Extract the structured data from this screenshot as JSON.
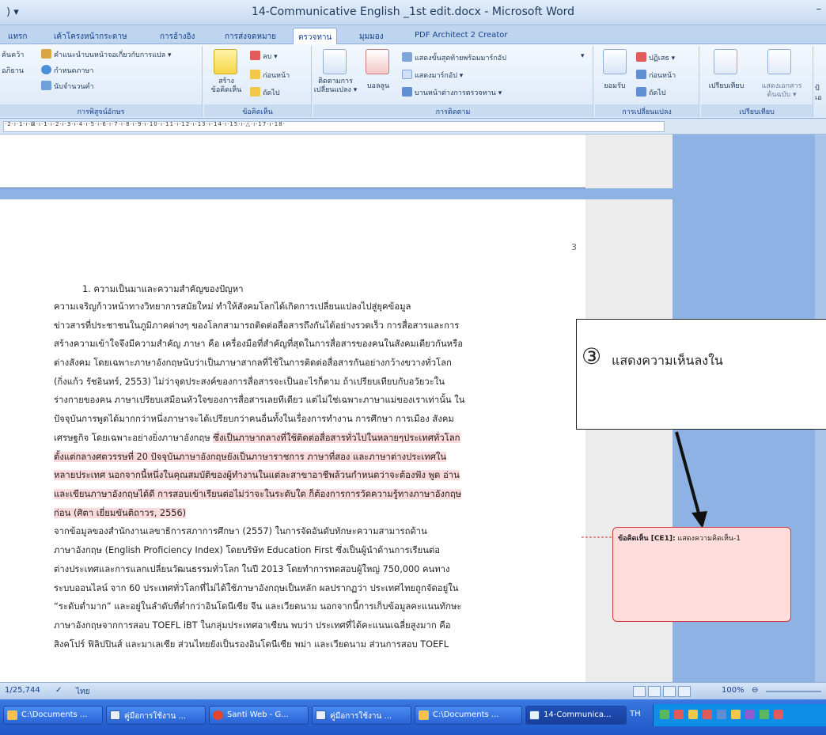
{
  "window": {
    "title": "14-Communicative English _1st edit.docx - Microsoft Word",
    "quick_access": ") ▾",
    "minimize": "–"
  },
  "tabs": [
    {
      "label": "แทรก"
    },
    {
      "label": "เค้าโครงหน้ากระดาษ"
    },
    {
      "label": "การอ้างอิง"
    },
    {
      "label": "การส่งจดหมาย"
    },
    {
      "label": "ตรวจทาน",
      "active": true
    },
    {
      "label": "มุมมอง"
    },
    {
      "label": "PDF Architect 2 Creator"
    }
  ],
  "ribbon": {
    "proofing": {
      "label": "การพิสูจน์อักษร",
      "items": [
        "ค้นคว้า",
        "คำแนะนำบนหน้าจอเกี่ยวกับการแปล ▾",
        "อภิธาน",
        "กำหนดภาษา",
        "นับจำนวนคำ"
      ]
    },
    "comments": {
      "label": "ข้อคิดเห็น",
      "new_comment": "สร้าง",
      "new_comment_2": "ข้อคิดเห็น",
      "delete": "ลบ ▾",
      "previous": "ก่อนหน้า",
      "next": "ถัดไป"
    },
    "tracking": {
      "label": "การติดตาม",
      "track_changes": "ติดตามการ",
      "track_changes_2": "เปลี่ยนแปลง ▾",
      "balloons": "บอลลูน",
      "display_select": "แสดงขั้นสุดท้ายพร้อมมาร์กอัป",
      "show_markup": "แสดงมาร์กอัป ▾",
      "reviewing_pane": "บานหน้าต่างการตรวจทาน ▾"
    },
    "changes": {
      "label": "การเปลี่ยนแปลง",
      "accept": "ยอมรับ",
      "reject": "ปฏิเสธ ▾",
      "previous": "ก่อนหน้า",
      "next": "ถัดไป"
    },
    "compare": {
      "label": "เปรียบเทียบ",
      "compare": "เปรียบเทียบ",
      "show_source": "แสดงเอกสาร",
      "show_source_2": "ต้นฉบับ ▾"
    },
    "extra": "ป้ เอ"
  },
  "ruler": {
    "ticks": "·2·ı·1·ı·⊠·ı·1·ı·2·ı·3·ı·4·ı·5·ı·6·ı·7·ı·8·ı·9·ı·10·ı·11·ı·12·ı·13·ı·14·ı·15·ı·△·ı·17·ı·18·"
  },
  "document": {
    "page_number": "3",
    "lines": [
      "1.  ความเป็นมาและความสำคัญของปัญหา",
      "          ความเจริญก้าวหน้าทางวิทยาการสมัยใหม่ ทำให้สังคมโลกได้เกิดการเปลี่ยนแปลงไปสู่ยุคข้อมูล",
      "ข่าวสารที่ประชาชนในภูมิภาคต่างๆ ของโลกสามารถติดต่อสื่อสารถึงกันได้อย่างรวดเร็ว การสื่อสารและการ",
      "สร้างความเข้าใจจึงมีความสำคัญ ภาษา คือ เครื่องมือที่สำคัญที่สุดในการสื่อสารของคนในสังคมเดียวกันหรือ",
      "ต่างสังคม โดยเฉพาะภาษาอังกฤษนับว่าเป็นภาษาสากลที่ใช้ในการติดต่อสื่อสารกันอย่างกว้างขวางทั่วโลก",
      "(กิ่งแก้ว รัชอินทร์, 2553) ไม่ว่าจุดประสงค์ของการสื่อสารจะเป็นอะไรก็ตาม ถ้าเปรียบเทียบกับอวัยวะใน",
      "ร่างกายของคน ภาษาเปรียบเสมือนหัวใจของการสื่อสารเลยทีเดียว แต่ไม่ใช่เฉพาะภาษาแม่ของเราเท่านั้น ใน",
      "ปัจจุบันการพูดได้มากกว่าหนึ่งภาษาจะได้เปรียบกว่าคนอื่นทั้งในเรื่องการทำงาน การศึกษา การเมือง สังคม",
      "เศรษฐกิจ โดยเฉพาะอย่างยิ่งภาษาอังกฤษ",
      "ตั้งแต่กลางศตวรรษที่ 20 ปัจจุบันภาษาอังกฤษยังเป็นภาษาราชการ ภาษาที่สอง และภาษาต่างประเทศใน",
      "หลายประเทศ นอกจากนี้หนึ่งในคุณสมบัติของผู้ทำงานในแต่ละสาขาอาชีพล้วนกำหนดว่าจะต้องฟัง พูด อ่าน",
      "และเขียนภาษาอังกฤษได้ดี การสอบเข้าเรียนต่อไม่ว่าจะในระดับใด ก็ต้องการการวัดความรู้ทางภาษาอังกฤษ",
      "ก่อน (ศิตา เยี่ยมขันติถาวร, 2556)",
      "          จากข้อมูลของสำนักงานเลขาธิการสภาการศึกษา (2557) ในการจัดอันดับทักษะความสามารถด้าน",
      "ภาษาอังกฤษ (English Proficiency Index) โดยบริษัท Education First ซึ่งเป็นผู้นำด้านการเรียนต่อ",
      "ต่างประเทศและการแลกเปลี่ยนวัฒนธรรมทั่วโลก ในปี 2013 โดยทำการทดสอบผู้ใหญ่ 750,000 คนทาง",
      "ระบบออนไลน์ จาก 60 ประเทศทั่วโลกที่ไม่ได้ใช้ภาษาอังกฤษเป็นหลัก ผลปรากฏว่า ประเทศไทยถูกจัดอยู่ใน",
      "“ระดับต่ำมาก” และอยู่ในลำดับที่ต่ำกว่าอินโดนีเซีย จีน และเวียดนาม นอกจากนี้การเก็บข้อมูลคะแนนทักษะ",
      "ภาษาอังกฤษจากการสอบ TOEFL iBT ในกลุ่มประเทศอาเซียน พบว่า ประเทศที่ได้คะแนนเฉลี่ยสูงมาก คือ",
      "สิงคโปร์ ฟิลิปปินส์ และมาเลเซีย ส่วนไทยยังเป็นรองอินโดนีเซีย พม่า และเวียดนาม ส่วนการสอบ TOEFL"
    ],
    "highlight_line8": "ซึ่งเป็นภาษากลางที่ใช้ติดต่อสื่อสารทั่วไปในหลายๆประเทศทั่วโลก"
  },
  "callout": {
    "number": "③",
    "text": "แสดงความเห็นลงใน"
  },
  "comment": {
    "tag": "ข้อคิดเห็น [CE1]:",
    "text": " แสดงความคิดเห็น-1"
  },
  "statusbar": {
    "words": "1/25,744",
    "lang": "ไทย",
    "zoom": "100%"
  },
  "taskbar": {
    "items": [
      {
        "label": "C:\\Documents ...",
        "color": "#f2c14e"
      },
      {
        "label": "คู่มือการใช้งาน ...",
        "color": "#2b5fb8"
      },
      {
        "label": "Santi Web - G...",
        "color": "#e2442f"
      },
      {
        "label": "คู่มือการใช้งาน ...",
        "color": "#2b5fb8"
      },
      {
        "label": "C:\\Documents ...",
        "color": "#f2c14e"
      },
      {
        "label": "14-Communica...",
        "color": "#2b5fb8",
        "active": true
      }
    ],
    "lang": "TH"
  }
}
